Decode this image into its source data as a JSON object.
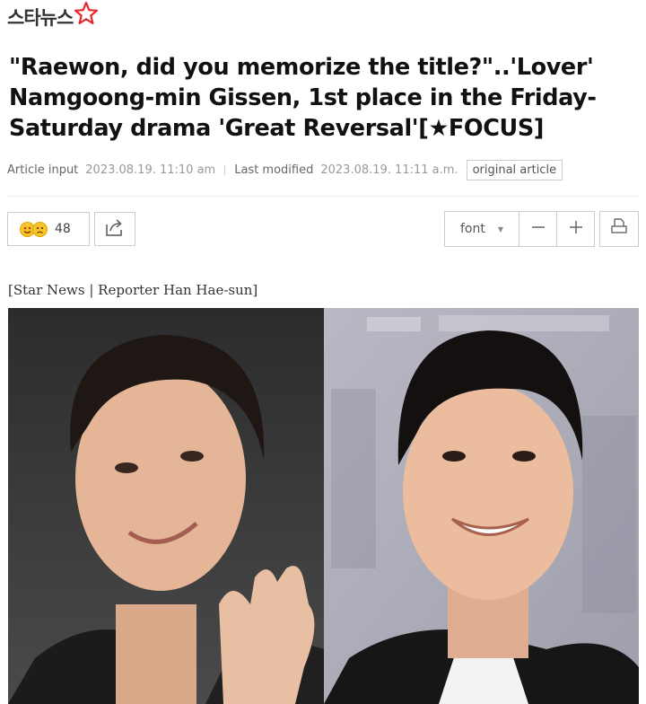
{
  "site": {
    "logo_text": "스타뉴스"
  },
  "article": {
    "headline": "\"Raewon, did you memorize the title?\"..'Lover' Namgoong-min Gissen, 1st place in the Friday-Saturday drama 'Great Reversal'[★FOCUS]",
    "meta": {
      "input_label": "Article input",
      "input_value": "2023.08.19. 11:10 am",
      "modified_label": "Last modified",
      "modified_value": "2023.08.19. 11:11 a.m.",
      "original_button": "original article"
    },
    "reactions": {
      "count": "48"
    },
    "toolbar": {
      "font_label": "font"
    },
    "photo_caption": "[Star News | Reporter Han Hae-sun]"
  },
  "colors": {
    "accent_star": "#e8262d",
    "border": "#cccccc",
    "meta_text": "#888888"
  },
  "icons": [
    "star-logo-icon",
    "smile-emoji-icon",
    "sad-emoji-icon",
    "share-icon",
    "dropdown-arrow-icon",
    "minus-icon",
    "plus-icon",
    "print-icon"
  ]
}
